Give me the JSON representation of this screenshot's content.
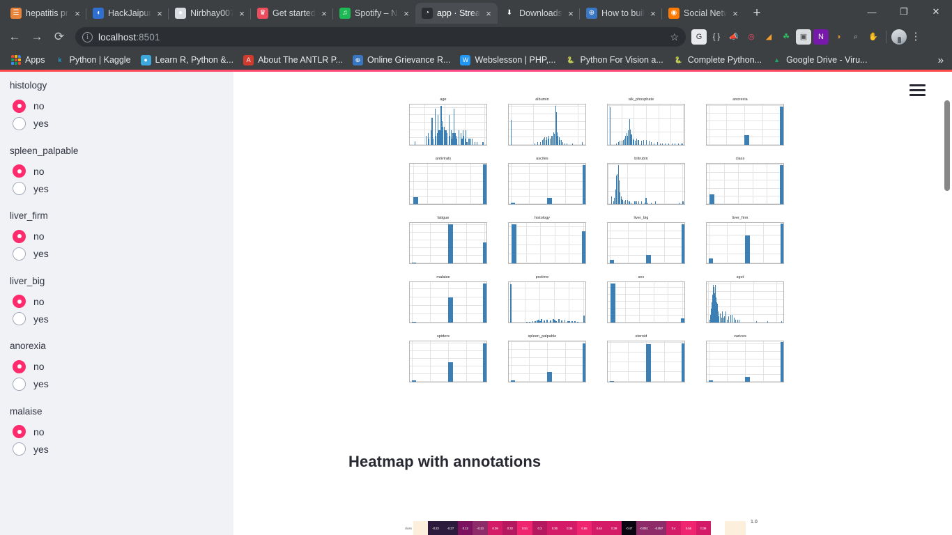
{
  "browser": {
    "tabs": [
      {
        "title": "hepatitis pr",
        "favicon": "book-icon",
        "color": "#e8833a",
        "glyph": "☰",
        "active": false
      },
      {
        "title": "HackJaipur",
        "favicon": "hackjaipur-icon",
        "color": "#2f6fd0",
        "glyph": "◖",
        "active": false
      },
      {
        "title": "Nirbhay007",
        "favicon": "github-icon",
        "color": "#d9dde1",
        "glyph": "●",
        "active": false
      },
      {
        "title": "Get started",
        "favicon": "crown-icon",
        "color": "#ed4c5c",
        "glyph": "♛",
        "active": false
      },
      {
        "title": "Spotify – N",
        "favicon": "spotify-icon",
        "color": "#1db954",
        "glyph": "♫",
        "active": false
      },
      {
        "title": "app · Stream",
        "favicon": "streamlit-icon",
        "color": "#2b2f33",
        "glyph": "◔",
        "active": true
      },
      {
        "title": "Downloads",
        "favicon": "download-icon",
        "color": "#3c4043",
        "glyph": "⬇",
        "active": false
      },
      {
        "title": "How to buil",
        "favicon": "globe-icon",
        "color": "#3a77c2",
        "glyph": "⊕",
        "active": false
      },
      {
        "title": "Social Netw",
        "favicon": "social-icon",
        "color": "#ff7a00",
        "glyph": "◉",
        "active": false
      }
    ],
    "new_tab_label": "+",
    "close_label": "×",
    "window_controls": {
      "minimize": "—",
      "maximize": "❐",
      "close": "✕"
    },
    "nav": {
      "back": "←",
      "forward": "→",
      "reload": "⟳"
    },
    "omnibox": {
      "info_icon_label": "i",
      "url_host": "localhost",
      "url_port": ":8501",
      "bookmark_star": "☆"
    },
    "extensions": [
      {
        "name": "grammarly-extension-icon",
        "glyph": "G",
        "color": "#e8eaed",
        "fg": "#3c4043"
      },
      {
        "name": "json-viewer-extension-icon",
        "glyph": "{ }",
        "color": "transparent",
        "fg": "#e8eaed"
      },
      {
        "name": "megaphone-extension-icon",
        "glyph": "📣",
        "color": "transparent",
        "fg": "#d8dade"
      },
      {
        "name": "spiral-extension-icon",
        "glyph": "◎",
        "color": "transparent",
        "fg": "#ef4a63"
      },
      {
        "name": "orange-arrow-extension-icon",
        "glyph": "◢",
        "color": "transparent",
        "fg": "#f59d2b"
      },
      {
        "name": "evernote-extension-icon",
        "glyph": "☘",
        "color": "transparent",
        "fg": "#2dbe60"
      },
      {
        "name": "screenshot-extension-icon",
        "glyph": "▣",
        "color": "#dadde0",
        "fg": "#555"
      },
      {
        "name": "onenote-extension-icon",
        "glyph": "N",
        "color": "#7719aa",
        "fg": "#fff"
      },
      {
        "name": "owl-extension-icon",
        "glyph": "◑",
        "color": "transparent",
        "fg": "#e0952a"
      },
      {
        "name": "bulb-extension-icon",
        "glyph": "⌕",
        "color": "transparent",
        "fg": "#b9bcc0"
      },
      {
        "name": "adblock-extension-icon",
        "glyph": "✋",
        "color": "transparent",
        "fg": "#e8142a"
      }
    ],
    "profile_avatar": "user-avatar",
    "menu_kebab": "⋮",
    "bookmarks": [
      {
        "label": "Apps",
        "icon": "apps-grid-icon",
        "color": "",
        "glyph": ""
      },
      {
        "label": "Python | Kaggle",
        "icon": "kaggle-icon",
        "color": "transparent",
        "glyph": "k",
        "fg": "#20beff"
      },
      {
        "label": "Learn R, Python &...",
        "icon": "datacamp-icon",
        "color": "#3ea8dd",
        "glyph": "●",
        "fg": "#fff"
      },
      {
        "label": "About The ANTLR P...",
        "icon": "antlr-icon",
        "color": "#d13b2e",
        "glyph": "A",
        "fg": "#fff"
      },
      {
        "label": "Online Grievance R...",
        "icon": "globe-icon",
        "color": "#3a77c2",
        "glyph": "⊕",
        "fg": "#fff"
      },
      {
        "label": "Webslesson | PHP,...",
        "icon": "webslesson-icon",
        "color": "#2196f3",
        "glyph": "W",
        "fg": "#fff"
      },
      {
        "label": "Python For Vision a...",
        "icon": "python-icon",
        "color": "transparent",
        "glyph": "🐍",
        "fg": "#ffd43b"
      },
      {
        "label": "Complete Python...",
        "icon": "python-icon",
        "color": "transparent",
        "glyph": "🐍",
        "fg": "#ffd43b"
      },
      {
        "label": "Google Drive - Viru...",
        "icon": "google-drive-icon",
        "color": "transparent",
        "glyph": "▲",
        "fg": "#1da462"
      }
    ],
    "bookmarks_overflow": "»"
  },
  "app": {
    "accent_color": "#ff4b4b",
    "sidebar_bg": "#f0f2f6",
    "menu_button": "hamburger-menu",
    "sidebar_fields": [
      {
        "label": "histology",
        "options": [
          "no",
          "yes"
        ],
        "selected": "no"
      },
      {
        "label": "spleen_palpable",
        "options": [
          "no",
          "yes"
        ],
        "selected": "no"
      },
      {
        "label": "liver_firm",
        "options": [
          "no",
          "yes"
        ],
        "selected": "no"
      },
      {
        "label": "liver_big",
        "options": [
          "no",
          "yes"
        ],
        "selected": "no"
      },
      {
        "label": "anorexia",
        "options": [
          "no",
          "yes"
        ],
        "selected": "no"
      },
      {
        "label": "malaise",
        "options": [
          "no",
          "yes"
        ],
        "selected": "no"
      }
    ],
    "heatmap_heading": "Heatmap with annotations",
    "heatmap_row_label": "class",
    "heatmap_colorbar_top_label": "1.0",
    "heatmap_values": [
      "-0.22",
      "-0.27",
      "0.12",
      "-0.13",
      "0.39",
      "0.32",
      "0.51",
      "0.3",
      "0.36",
      "0.38",
      "0.55",
      "0.44",
      "0.39",
      "-0.47",
      "-0.051",
      "-0.057",
      "0.4",
      "0.55",
      "0.38"
    ]
  },
  "chart_data": [
    {
      "type": "histogram",
      "title": "age",
      "xlabel": "",
      "ylabel": "",
      "xticks": [
        20,
        40,
        60,
        80
      ],
      "yticks": [
        0.0,
        2.5,
        5.0,
        7.5,
        10.0,
        12.5
      ],
      "xlim": [
        5,
        82
      ],
      "ylim": [
        0,
        13.5
      ],
      "bins_x": [
        10,
        21,
        23,
        24,
        26,
        27,
        28,
        30,
        31,
        32,
        33,
        34,
        35,
        36,
        37,
        38,
        39,
        40,
        41,
        42,
        44,
        45,
        46,
        47,
        48,
        49,
        50,
        51,
        52,
        54,
        56,
        57,
        58,
        59,
        60,
        61,
        62,
        64,
        66,
        67,
        70,
        72,
        78
      ],
      "values": [
        1.2,
        3,
        4,
        2,
        5,
        9,
        2,
        12,
        3,
        4,
        10,
        5,
        5,
        13,
        8,
        6,
        6,
        5,
        5,
        4,
        10,
        3,
        5,
        2,
        4,
        12,
        4,
        3,
        2,
        5,
        4,
        2,
        5,
        3,
        2,
        5,
        1,
        2,
        2,
        2,
        1,
        1,
        1
      ]
    },
    {
      "type": "histogram",
      "title": "albumin",
      "xticks": [
        0,
        2,
        4,
        6
      ],
      "yticks": [
        0,
        5,
        10,
        15,
        20,
        25
      ],
      "xlim": [
        -0.2,
        6.7
      ],
      "ylim": [
        0,
        26
      ],
      "bins_x": [
        0,
        2.1,
        2.4,
        2.6,
        2.8,
        2.9,
        3.0,
        3.1,
        3.2,
        3.3,
        3.4,
        3.5,
        3.6,
        3.7,
        3.8,
        3.9,
        4.0,
        4.05,
        4.1,
        4.2,
        4.3,
        4.4,
        4.5,
        4.6,
        4.8,
        5.0,
        5.5,
        6.4
      ],
      "values": [
        16,
        1,
        2,
        2,
        3,
        4,
        5,
        3,
        5,
        4,
        6,
        4,
        6,
        6,
        8,
        7,
        25,
        21,
        8,
        6,
        5,
        3,
        3,
        2,
        1,
        1,
        1,
        2
      ]
    },
    {
      "type": "histogram",
      "title": "alk_phosphate",
      "xticks": [
        0,
        50,
        100,
        150,
        200,
        250,
        300
      ],
      "yticks": [
        0,
        10,
        20,
        30
      ],
      "xlim": [
        -5,
        305
      ],
      "ylim": [
        0,
        31
      ],
      "bins_x": [
        3,
        28,
        36,
        44,
        50,
        56,
        62,
        66,
        70,
        74,
        78,
        82,
        85,
        88,
        92,
        96,
        100,
        105,
        110,
        115,
        120,
        130,
        140,
        150,
        160,
        170,
        180,
        195,
        205,
        215,
        225,
        240,
        255,
        265,
        280,
        290,
        297
      ],
      "values": [
        29,
        1,
        2,
        3,
        3,
        4,
        5,
        7,
        9,
        7,
        11,
        20,
        12,
        8,
        8,
        5,
        4,
        3,
        5,
        4,
        4,
        3,
        4,
        4,
        3,
        2,
        1,
        2,
        1,
        1,
        1,
        1,
        1,
        1,
        1,
        1,
        1
      ]
    },
    {
      "type": "histogram",
      "title": "anorexia",
      "xticks": [
        0.0,
        0.5,
        1.0,
        1.5,
        2.0
      ],
      "yticks": [
        0,
        25,
        50,
        75,
        100,
        125
      ],
      "xlim": [
        -0.05,
        2.08
      ],
      "ylim": [
        0,
        128
      ],
      "bins_x": [
        0.0,
        1.0,
        1.98
      ],
      "values": [
        1,
        31,
        121
      ]
    },
    {
      "type": "histogram",
      "title": "antivirals",
      "xticks": [
        1.0,
        1.2,
        1.4,
        1.6,
        1.8,
        2.0
      ],
      "yticks": [
        0,
        25,
        50,
        75,
        100,
        125
      ],
      "xlim": [
        0.95,
        2.03
      ],
      "ylim": [
        0,
        134
      ],
      "bins_x": [
        1.0,
        1.98
      ],
      "values": [
        24,
        131
      ]
    },
    {
      "type": "histogram",
      "title": "ascites",
      "xticks": [
        0.0,
        0.5,
        1.0,
        1.5,
        2.0
      ],
      "yticks": [
        0,
        25,
        50,
        75,
        100,
        125
      ],
      "xlim": [
        -0.05,
        2.05
      ],
      "ylim": [
        0,
        134
      ],
      "bins_x": [
        0.0,
        1.0,
        1.98
      ],
      "values": [
        5,
        20,
        130
      ]
    },
    {
      "type": "histogram",
      "title": "bilirubin",
      "xticks": [
        0,
        2,
        4,
        6,
        8
      ],
      "yticks": [
        0,
        10,
        20,
        30
      ],
      "xlim": [
        -0.1,
        8.2
      ],
      "ylim": [
        0,
        31
      ],
      "bins_x": [
        0.3,
        0.5,
        0.6,
        0.7,
        0.8,
        0.9,
        1.0,
        1.1,
        1.2,
        1.3,
        1.4,
        1.5,
        1.6,
        1.8,
        2.0,
        2.2,
        2.4,
        2.8,
        3.0,
        3.2,
        3.5,
        3.9,
        4.0,
        4.2,
        4.6,
        5.0,
        7.6,
        8.0
      ],
      "values": [
        6,
        2,
        5,
        11,
        22,
        23,
        30,
        18,
        9,
        6,
        4,
        3,
        2,
        3,
        3,
        2,
        1,
        2,
        2,
        2,
        2,
        1,
        5,
        1,
        1,
        2,
        1,
        2
      ]
    },
    {
      "type": "histogram",
      "title": "class",
      "xticks": [
        1.0,
        1.2,
        1.4,
        1.6,
        1.8,
        2.0
      ],
      "yticks": [
        0,
        25,
        50,
        75,
        100,
        125
      ],
      "xlim": [
        0.96,
        2.03
      ],
      "ylim": [
        0,
        128
      ],
      "bins_x": [
        1.0,
        1.98
      ],
      "values": [
        32,
        123
      ]
    },
    {
      "type": "histogram",
      "title": "fatigue",
      "xticks": [
        0.0,
        0.5,
        1.0,
        1.5,
        2.0
      ],
      "yticks": [
        0,
        20,
        40,
        60,
        80,
        100
      ],
      "xlim": [
        -0.05,
        2.05
      ],
      "ylim": [
        0,
        104
      ],
      "bins_x": [
        0.0,
        1.0,
        1.96
      ],
      "values": [
        1,
        100,
        53
      ]
    },
    {
      "type": "histogram",
      "title": "histology",
      "xticks": [
        1.0,
        1.2,
        1.4,
        1.6,
        1.8,
        2.0
      ],
      "yticks": [
        0,
        20,
        40,
        60,
        80
      ],
      "xlim": [
        0.96,
        2.03
      ],
      "ylim": [
        0,
        88
      ],
      "bins_x": [
        1.0,
        1.98
      ],
      "values": [
        85,
        70
      ]
    },
    {
      "type": "histogram",
      "title": "liver_big",
      "xticks": [
        0.0,
        0.5,
        1.0,
        1.5,
        2.0
      ],
      "yticks": [
        0,
        25,
        50,
        75,
        100,
        125
      ],
      "xlim": [
        -0.05,
        2.05
      ],
      "ylim": [
        0,
        124
      ],
      "bins_x": [
        0.0,
        1.0,
        1.97
      ],
      "values": [
        10,
        25,
        120
      ]
    },
    {
      "type": "histogram",
      "title": "liver_firm",
      "xticks": [
        0.0,
        0.5,
        1.0,
        1.5,
        2.0
      ],
      "yticks": [
        0,
        20,
        40,
        60,
        80
      ],
      "xlim": [
        -0.05,
        2.05
      ],
      "ylim": [
        0,
        86
      ],
      "bins_x": [
        0.0,
        1.0,
        1.97
      ],
      "values": [
        11,
        60,
        84
      ]
    },
    {
      "type": "histogram",
      "title": "malaise",
      "xticks": [
        0.0,
        0.5,
        1.0,
        1.5,
        2.0
      ],
      "yticks": [
        0,
        20,
        40,
        60,
        80
      ],
      "xlim": [
        -0.05,
        2.05
      ],
      "ylim": [
        0,
        96
      ],
      "bins_x": [
        0.0,
        1.0,
        1.96
      ],
      "values": [
        1,
        60,
        93
      ]
    },
    {
      "type": "histogram",
      "title": "protime",
      "xticks": [
        0,
        20,
        40,
        60,
        80,
        100
      ],
      "yticks": [
        0,
        20,
        40,
        60
      ],
      "xlim": [
        -2,
        103
      ],
      "ylim": [
        0,
        70
      ],
      "bins_x": [
        0,
        22,
        26,
        30,
        33,
        36,
        38,
        40,
        42,
        46,
        50,
        54,
        58,
        60,
        62,
        66,
        70,
        74,
        78,
        80,
        84,
        88,
        92,
        100
      ],
      "values": [
        67,
        1,
        1,
        2,
        3,
        4,
        5,
        3,
        6,
        4,
        5,
        4,
        6,
        5,
        3,
        6,
        4,
        5,
        3,
        3,
        2,
        2,
        1,
        12
      ]
    },
    {
      "type": "histogram",
      "title": "sex",
      "xticks": [
        1.0,
        1.2,
        1.4,
        1.6,
        1.8,
        2.0
      ],
      "yticks": [
        0,
        25,
        50,
        75,
        100,
        125
      ],
      "xlim": [
        0.96,
        2.03
      ],
      "ylim": [
        0,
        145
      ],
      "bins_x": [
        1.0,
        1.98
      ],
      "values": [
        139,
        16
      ]
    },
    {
      "type": "histogram",
      "title": "sgot",
      "xticks": [
        0,
        200,
        400,
        600
      ],
      "yticks": [
        0,
        5,
        10,
        15,
        20,
        25
      ],
      "xlim": [
        -10,
        660
      ],
      "ylim": [
        0,
        26
      ],
      "bins_x": [
        14,
        20,
        26,
        32,
        38,
        44,
        50,
        56,
        62,
        68,
        74,
        80,
        86,
        95,
        105,
        115,
        125,
        135,
        145,
        155,
        165,
        180,
        195,
        210,
        225,
        240,
        255,
        270,
        420,
        520,
        640
      ],
      "values": [
        2,
        5,
        9,
        13,
        18,
        24,
        23,
        19,
        24,
        16,
        13,
        12,
        7,
        4,
        6,
        3,
        7,
        3,
        4,
        7,
        2,
        4,
        5,
        5,
        3,
        2,
        2,
        2,
        1,
        1,
        1
      ]
    },
    {
      "type": "histogram",
      "title": "spiders",
      "xticks": [
        0.0,
        0.5,
        1.0,
        1.5,
        2.0
      ],
      "yticks": [
        0,
        20,
        40,
        60,
        80,
        100
      ],
      "xlim": [
        -0.05,
        2.05
      ],
      "ylim": [
        0,
        104
      ],
      "bins_x": [
        0.0,
        1.0,
        1.96
      ],
      "values": [
        4,
        51,
        99
      ]
    },
    {
      "type": "histogram",
      "title": "spleen_palpable",
      "xticks": [
        0.0,
        0.5,
        1.0,
        1.5,
        2.0
      ],
      "yticks": [
        0,
        25,
        50,
        75,
        100,
        125
      ],
      "xlim": [
        -0.05,
        2.05
      ],
      "ylim": [
        0,
        126
      ],
      "bins_x": [
        0.0,
        1.0,
        1.97
      ],
      "values": [
        5,
        30,
        120
      ]
    },
    {
      "type": "histogram",
      "title": "steroid",
      "xticks": [
        0.0,
        0.5,
        1.0,
        1.5,
        2.0
      ],
      "yticks": [
        0,
        20,
        40,
        60,
        80
      ],
      "xlim": [
        -0.05,
        2.05
      ],
      "ylim": [
        0,
        82
      ],
      "bins_x": [
        0.0,
        1.0,
        1.97
      ],
      "values": [
        1,
        76,
        78
      ]
    },
    {
      "type": "histogram",
      "title": "varices",
      "xticks": [
        0.0,
        0.5,
        1.0,
        1.5,
        2.0
      ],
      "yticks": [
        0,
        25,
        50,
        75,
        100,
        125
      ],
      "xlim": [
        -0.05,
        2.05
      ],
      "ylim": [
        0,
        134
      ],
      "bins_x": [
        0.0,
        1.0,
        1.97
      ],
      "values": [
        5,
        17,
        131
      ]
    }
  ]
}
